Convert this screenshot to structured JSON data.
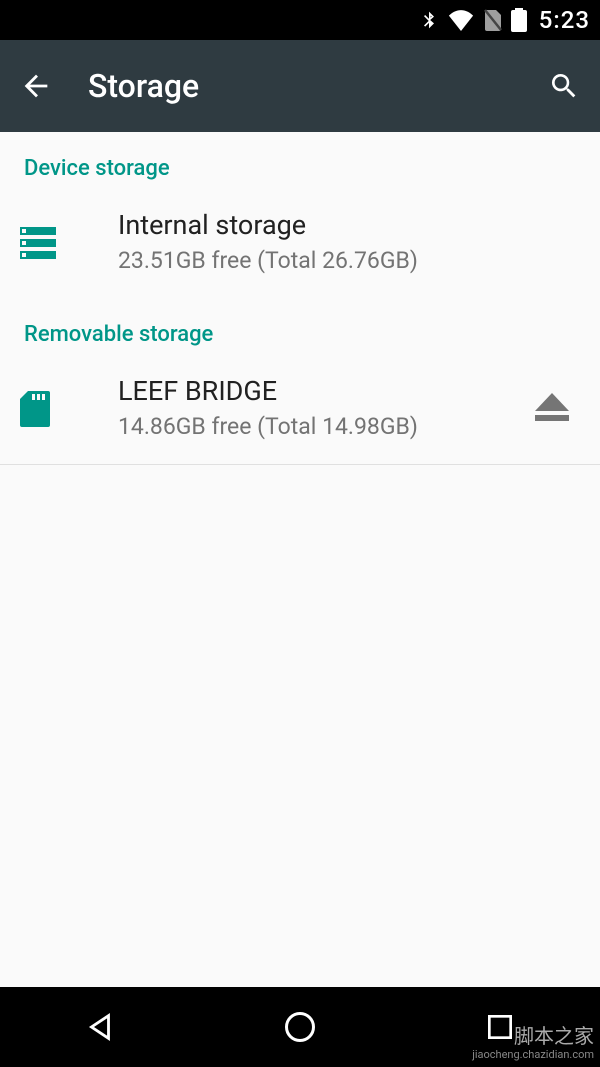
{
  "status": {
    "time": "5:23"
  },
  "appbar": {
    "title": "Storage"
  },
  "sections": {
    "device_header": "Device storage",
    "removable_header": "Removable storage"
  },
  "internal": {
    "title": "Internal storage",
    "subtitle": "23.51GB free (Total 26.76GB)"
  },
  "removable": {
    "title": "LEEF BRIDGE",
    "subtitle": "14.86GB free (Total 14.98GB)"
  },
  "watermark": {
    "line1": "脚本之家",
    "line2": "jiaocheng.chazidian.com"
  },
  "colors": {
    "accent": "#009688",
    "appbar": "#2f3b41"
  }
}
